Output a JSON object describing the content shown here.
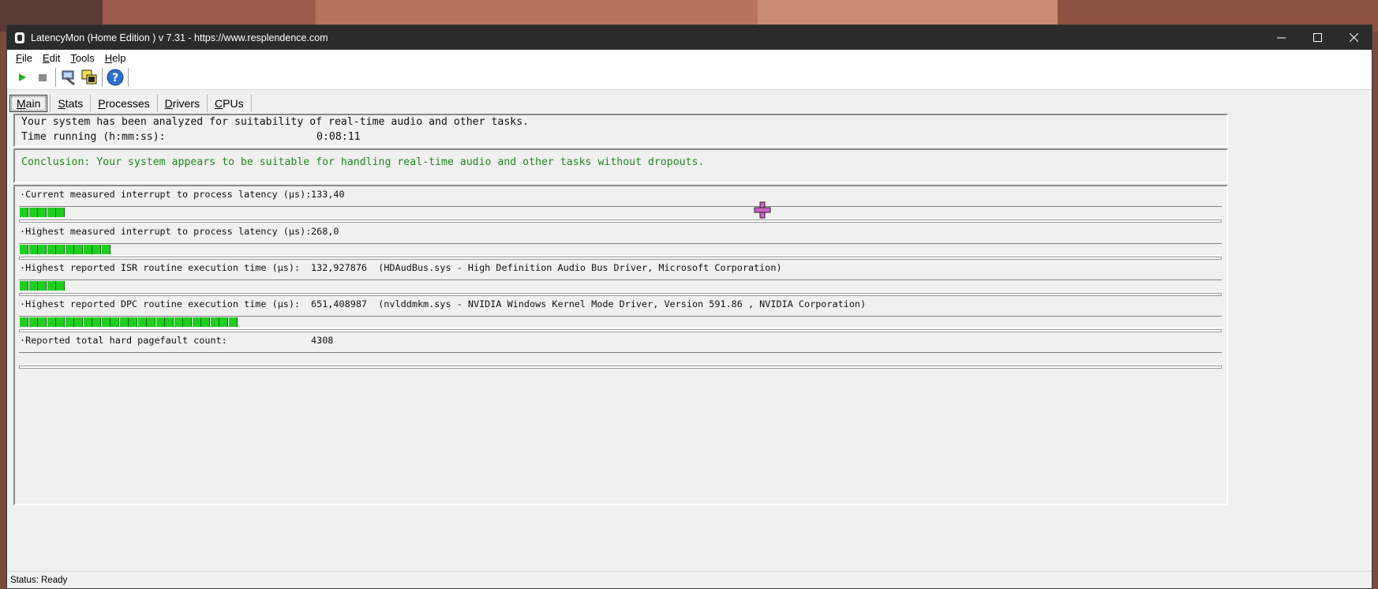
{
  "window": {
    "title": "LatencyMon  (Home Edition )  v 7.31 - https://www.resplendence.com"
  },
  "menu": [
    {
      "u": "F",
      "rest": "ile"
    },
    {
      "u": "E",
      "rest": "dit"
    },
    {
      "u": "T",
      "rest": "ools"
    },
    {
      "u": "H",
      "rest": "elp"
    }
  ],
  "tabs": [
    {
      "u": "M",
      "rest": "ain",
      "active": true
    },
    {
      "u": "S",
      "rest": "tats"
    },
    {
      "u": "P",
      "rest": "rocesses"
    },
    {
      "u": "D",
      "rest": "rivers"
    },
    {
      "u": "C",
      "rest": "PUs"
    }
  ],
  "info": {
    "line1": "Your system has been analyzed for suitability of real-time audio and other tasks.",
    "time_label": "Time running (h:mm:ss):",
    "time_value": "0:08:11"
  },
  "conclusion": "Conclusion: Your system appears to be suitable for handling real-time audio and other tasks without dropouts.",
  "metrics": [
    {
      "label": "·Current measured interrupt to process latency (µs):",
      "value": "133,40",
      "segments": 5
    },
    {
      "label": "·Highest measured interrupt to process latency (µs):",
      "value": "268,0",
      "segments": 10
    },
    {
      "label": "·Highest reported ISR routine execution time (µs):",
      "value": "132,927876  (HDAudBus.sys - High Definition Audio Bus Driver, Microsoft Corporation)",
      "segments": 5
    },
    {
      "label": "·Highest reported DPC routine execution time (µs):",
      "value": "651,408987  (nvlddmkm.sys - NVIDIA Windows Kernel Mode Driver, Version 591.86 , NVIDIA Corporation)",
      "segments": 24
    },
    {
      "label": "·Reported total hard pagefault count:",
      "value": "4308",
      "segments": 0
    }
  ],
  "status": "Status: Ready",
  "colors": {
    "bar_green": "#1fcf1f",
    "conclusion_green": "#1e8a1e"
  }
}
